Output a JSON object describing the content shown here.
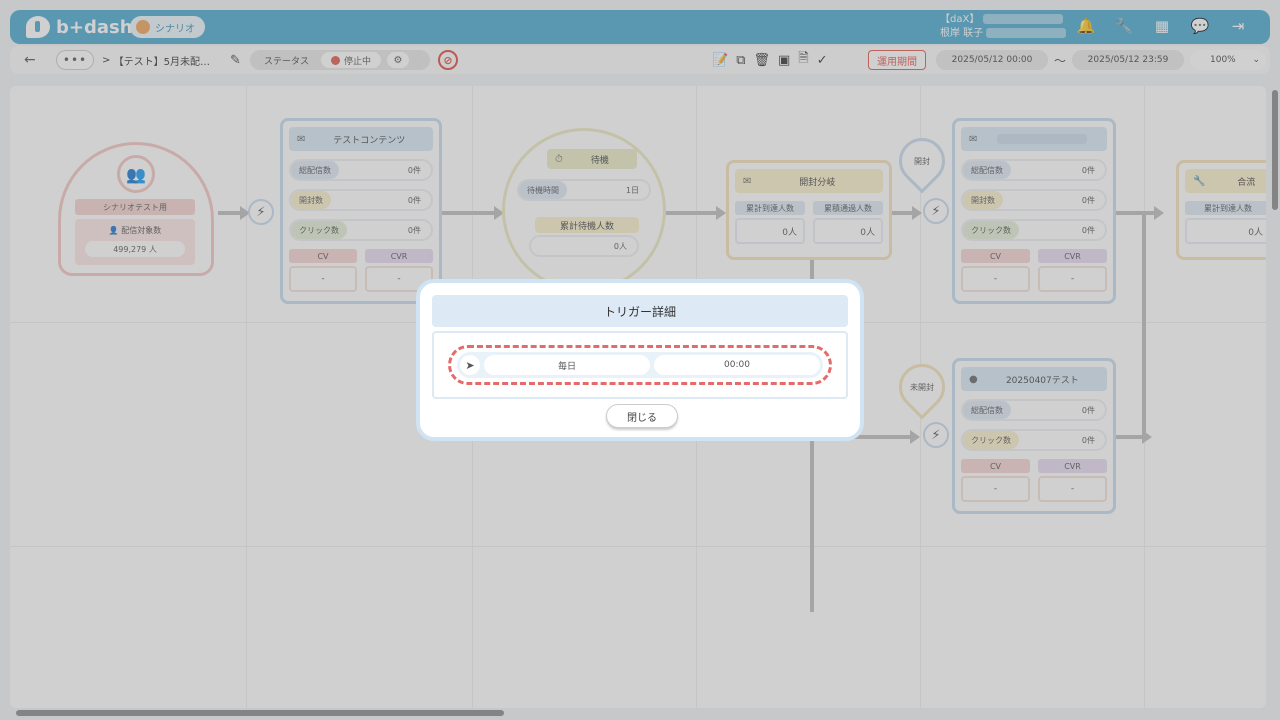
{
  "header": {
    "logo": "b+dash",
    "scenario_tab": "シナリオ",
    "user_org": "【daX】",
    "user_name": "根岸 联子",
    "icons": [
      "bell-icon",
      "wrench-icon",
      "grid-icon",
      "chat-icon",
      "logout-icon"
    ]
  },
  "toolbar": {
    "breadcrumb_sep": ">",
    "breadcrumb_title": "【テスト】5月未配…",
    "status_label": "ステータス",
    "status_value": "停止中",
    "period_button": "運用期間",
    "date_from": "2025/05/12 00:00",
    "tilde": "～",
    "date_to": "2025/05/12 23:59",
    "zoom": "100%"
  },
  "canvas": {
    "audience": {
      "name": "シナリオテスト用",
      "label": "配信対象数",
      "value": "499,279 人"
    },
    "content1": {
      "title": "テストコンテンツ",
      "rows": [
        [
          "総配信数",
          "0件"
        ],
        [
          "開封数",
          "0件"
        ],
        [
          "クリック数",
          "0件"
        ]
      ],
      "cv": "CV",
      "cvr": "CVR",
      "cv_val": "-",
      "cvr_val": "-"
    },
    "wait": {
      "title": "待機",
      "row1_label": "待機時間",
      "row1_val": "1日",
      "row2_label": "累計待機人数",
      "row2_val": "0人"
    },
    "branch": {
      "title": "開封分岐",
      "c1": "累計到達人数",
      "c2": "累積通過人数",
      "v1": "0人",
      "v2": "0人"
    },
    "pin_open": "開封",
    "pin_unopened": "未開封",
    "content2": {
      "rows": [
        [
          "総配信数",
          "0件"
        ],
        [
          "開封数",
          "0件"
        ],
        [
          "クリック数",
          "0件"
        ]
      ],
      "cv": "CV",
      "cvr": "CVR",
      "cv_val": "-",
      "cvr_val": "-"
    },
    "content3": {
      "title": "20250407テスト",
      "rows": [
        [
          "総配信数",
          "0件"
        ],
        [
          "クリック数",
          "0件"
        ]
      ],
      "cv": "CV",
      "cvr": "CVR",
      "cv_val": "-",
      "cvr_val": "-"
    },
    "merge": {
      "title": "合流",
      "c1": "累計到達人数",
      "v1": "0人"
    }
  },
  "modal": {
    "title": "トリガー詳細",
    "frequency": "毎日",
    "time": "00:00",
    "close": "閉じる"
  }
}
